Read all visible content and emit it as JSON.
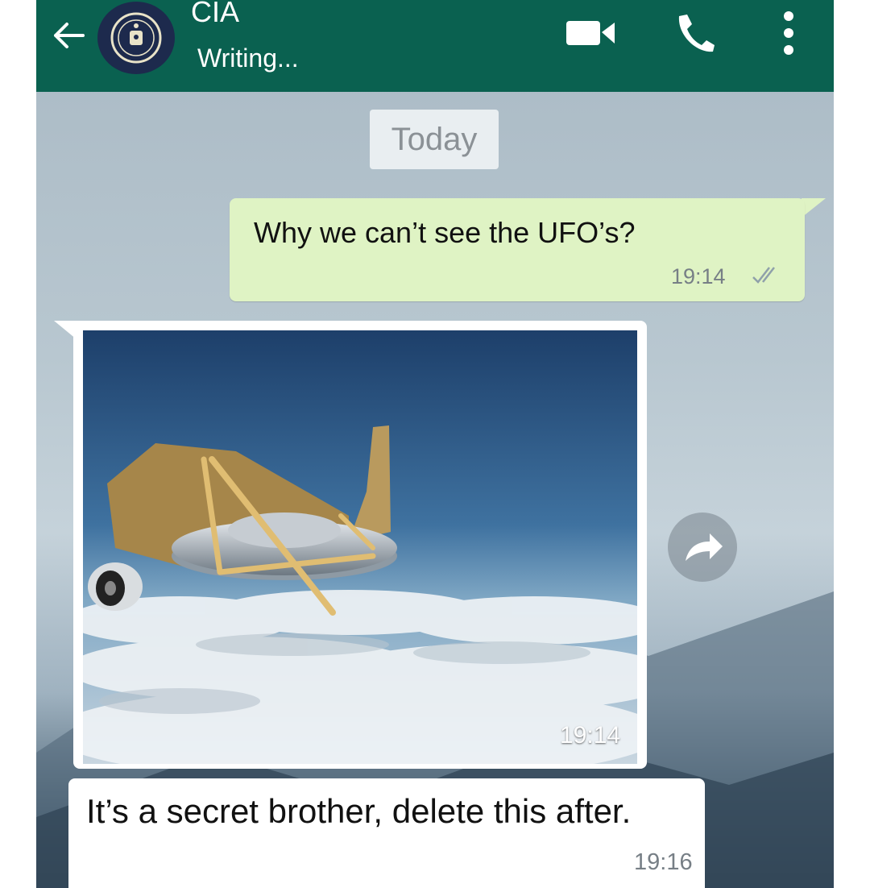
{
  "header": {
    "contact_name": "CIA",
    "status": "Writing...",
    "icons": [
      "back-arrow-icon",
      "cia-seal-icon",
      "video-call-icon",
      "phone-icon",
      "more-options-icon"
    ]
  },
  "chat": {
    "date_separator": "Today",
    "messages": [
      {
        "direction": "outgoing",
        "type": "text",
        "text": "Why we can’t see the UFO’s?",
        "time": "19:14",
        "status": "read-ticks-icon"
      },
      {
        "direction": "incoming",
        "type": "image",
        "time": "19:14"
      },
      {
        "direction": "incoming",
        "type": "text",
        "text": "It’s a secret brother, delete this after.",
        "time": "19:16"
      }
    ]
  },
  "colors": {
    "header": "#0a6150",
    "outgoing_bubble": "#dff3c4",
    "incoming_bubble": "#ffffff",
    "date_chip": "#e9eef1"
  }
}
